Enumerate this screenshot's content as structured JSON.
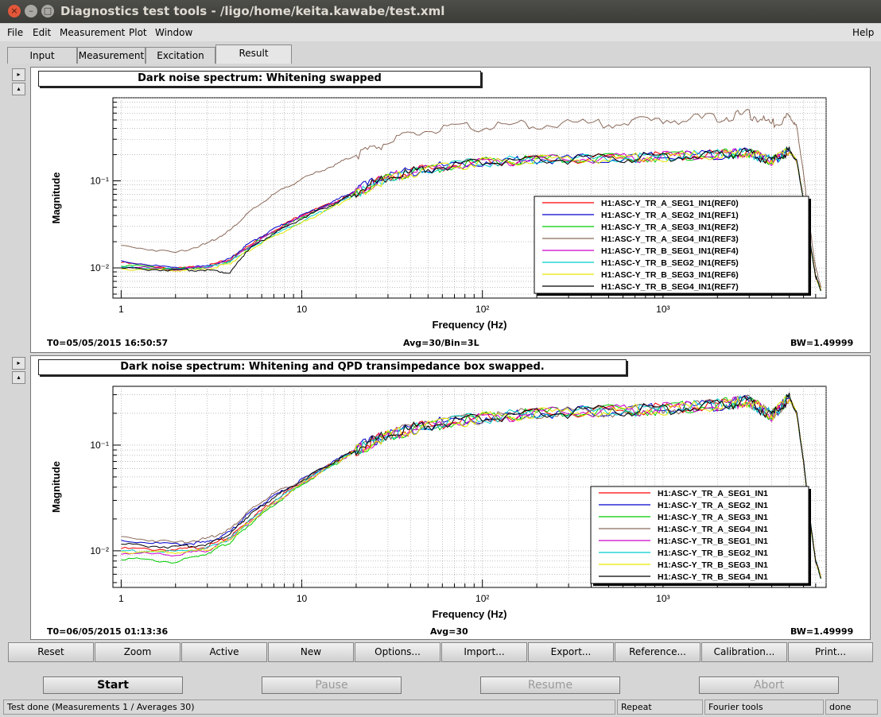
{
  "window": {
    "title": "Diagnostics test tools - /ligo/home/keita.kawabe/test.xml",
    "controls": [
      "×",
      "–",
      "□"
    ]
  },
  "menu": {
    "items": [
      "File",
      "Edit",
      "Measurement",
      "Plot",
      "Window"
    ],
    "help": "Help"
  },
  "tabs": [
    "Input",
    "Measurement",
    "Excitation",
    "Result"
  ],
  "side_buttons": {
    "expand": "▸",
    "collapse": "▴"
  },
  "plots": [
    {
      "title": "Dark noise spectrum: Whitening swapped",
      "t0": "T0=05/05/2015 16:50:57",
      "avg": "Avg=30/Bin=3L",
      "bw": "BW=1.49999"
    },
    {
      "title": "Dark noise spectrum: Whitening and QPD transimpedance box swapped.",
      "t0": "T0=06/05/2015 01:13:36",
      "avg": "Avg=30",
      "bw": "BW=1.49999"
    }
  ],
  "chart_data": [
    {
      "type": "line",
      "title": "Dark noise spectrum: Whitening swapped",
      "xlabel": "Frequency (Hz)",
      "ylabel": "Magnitude",
      "xscale": "log",
      "yscale": "log",
      "xlim": [
        0.9,
        8000
      ],
      "ylim": [
        0.0045,
        0.9
      ],
      "x_ticks": [
        "1",
        "10",
        "10²",
        "10³"
      ],
      "y_ticks": [
        "10⁻²",
        "10⁻¹"
      ],
      "grid": true,
      "legend": "bottom-right",
      "x": [
        1,
        2,
        3,
        4,
        5,
        7,
        10,
        15,
        20,
        30,
        50,
        100,
        200,
        500,
        1000,
        2000,
        3000,
        4000,
        5000,
        5500,
        6000,
        6500,
        7000,
        7500
      ],
      "series": [
        {
          "name": "H1:ASC-Y_TR_A_SEG1_IN1(REF0)",
          "color": "#ff0000",
          "values": [
            0.0115,
            0.0098,
            0.0105,
            0.0125,
            0.018,
            0.027,
            0.041,
            0.056,
            0.075,
            0.11,
            0.14,
            0.165,
            0.175,
            0.18,
            0.19,
            0.2,
            0.21,
            0.17,
            0.22,
            0.17,
            0.06,
            0.02,
            0.008,
            0.0055
          ]
        },
        {
          "name": "H1:ASC-Y_TR_A_SEG2_IN1(REF1)",
          "color": "#0000cc",
          "values": [
            0.012,
            0.0099,
            0.0104,
            0.0126,
            0.0185,
            0.028,
            0.04,
            0.058,
            0.078,
            0.115,
            0.14,
            0.165,
            0.176,
            0.18,
            0.19,
            0.2,
            0.21,
            0.17,
            0.22,
            0.17,
            0.06,
            0.02,
            0.008,
            0.0055
          ]
        },
        {
          "name": "H1:ASC-Y_TR_A_SEG3_IN1(REF2)",
          "color": "#00cc00",
          "values": [
            0.0108,
            0.0097,
            0.0103,
            0.012,
            0.017,
            0.026,
            0.038,
            0.055,
            0.073,
            0.11,
            0.138,
            0.163,
            0.175,
            0.18,
            0.19,
            0.2,
            0.21,
            0.17,
            0.22,
            0.17,
            0.06,
            0.02,
            0.008,
            0.0055
          ]
        },
        {
          "name": "H1:ASC-Y_TR_A_SEG4_IN1(REF3)",
          "color": "#8b6a5a",
          "values": [
            0.018,
            0.015,
            0.019,
            0.027,
            0.042,
            0.07,
            0.105,
            0.15,
            0.2,
            0.28,
            0.38,
            0.42,
            0.44,
            0.46,
            0.5,
            0.53,
            0.58,
            0.45,
            0.55,
            0.42,
            0.12,
            0.03,
            0.01,
            0.006
          ]
        },
        {
          "name": "H1:ASC-Y_TR_B_SEG1_IN1(REF4)",
          "color": "#cc00cc",
          "values": [
            0.0103,
            0.0096,
            0.0102,
            0.0122,
            0.017,
            0.026,
            0.039,
            0.055,
            0.074,
            0.11,
            0.139,
            0.164,
            0.175,
            0.18,
            0.19,
            0.2,
            0.21,
            0.17,
            0.22,
            0.17,
            0.06,
            0.02,
            0.008,
            0.0055
          ]
        },
        {
          "name": "H1:ASC-Y_TR_B_SEG2_IN1(REF5)",
          "color": "#00cccc",
          "values": [
            0.0102,
            0.0096,
            0.01,
            0.0118,
            0.016,
            0.024,
            0.034,
            0.052,
            0.071,
            0.108,
            0.137,
            0.163,
            0.175,
            0.18,
            0.19,
            0.2,
            0.21,
            0.17,
            0.22,
            0.17,
            0.06,
            0.02,
            0.008,
            0.0055
          ]
        },
        {
          "name": "H1:ASC-Y_TR_B_SEG3_IN1(REF6)",
          "color": "#e6e600",
          "values": [
            0.0098,
            0.0093,
            0.0097,
            0.0112,
            0.0155,
            0.023,
            0.033,
            0.05,
            0.07,
            0.106,
            0.137,
            0.163,
            0.175,
            0.18,
            0.19,
            0.2,
            0.21,
            0.17,
            0.22,
            0.17,
            0.06,
            0.02,
            0.008,
            0.0055
          ]
        },
        {
          "name": "H1:ASC-Y_TR_B_SEG4_IN1(REF7)",
          "color": "#000000",
          "values": [
            0.0099,
            0.0094,
            0.0095,
            0.0088,
            0.016,
            0.025,
            0.037,
            0.054,
            0.073,
            0.11,
            0.138,
            0.164,
            0.175,
            0.18,
            0.19,
            0.2,
            0.21,
            0.17,
            0.22,
            0.17,
            0.06,
            0.02,
            0.008,
            0.0055
          ]
        }
      ]
    },
    {
      "type": "line",
      "title": "Dark noise spectrum: Whitening and QPD transimpedance box swapped.",
      "xlabel": "Frequency (Hz)",
      "ylabel": "Magnitude",
      "xscale": "log",
      "yscale": "log",
      "xlim": [
        0.9,
        8000
      ],
      "ylim": [
        0.0045,
        0.36
      ],
      "x_ticks": [
        "1",
        "10",
        "10²",
        "10³"
      ],
      "y_ticks": [
        "10⁻²",
        "10⁻¹"
      ],
      "grid": true,
      "legend": "bottom-right",
      "x": [
        1,
        2,
        3,
        4,
        5,
        7,
        10,
        15,
        20,
        30,
        50,
        100,
        200,
        500,
        1000,
        2000,
        3000,
        4000,
        5000,
        5500,
        6000,
        6500,
        7000,
        7500
      ],
      "series": [
        {
          "name": "H1:ASC-Y_TR_A_SEG1_IN1",
          "color": "#ff0000",
          "values": [
            0.0105,
            0.0102,
            0.011,
            0.0135,
            0.019,
            0.03,
            0.045,
            0.068,
            0.09,
            0.125,
            0.155,
            0.18,
            0.2,
            0.21,
            0.22,
            0.24,
            0.26,
            0.19,
            0.28,
            0.2,
            0.07,
            0.02,
            0.008,
            0.0055
          ]
        },
        {
          "name": "H1:ASC-Y_TR_A_SEG2_IN1",
          "color": "#0000cc",
          "values": [
            0.0125,
            0.0115,
            0.012,
            0.015,
            0.022,
            0.033,
            0.047,
            0.07,
            0.092,
            0.127,
            0.156,
            0.181,
            0.2,
            0.21,
            0.22,
            0.24,
            0.26,
            0.19,
            0.28,
            0.2,
            0.07,
            0.02,
            0.008,
            0.0055
          ]
        },
        {
          "name": "H1:ASC-Y_TR_A_SEG3_IN1",
          "color": "#00cc00",
          "values": [
            0.0085,
            0.0078,
            0.0095,
            0.012,
            0.017,
            0.027,
            0.042,
            0.065,
            0.088,
            0.123,
            0.154,
            0.18,
            0.2,
            0.21,
            0.22,
            0.24,
            0.26,
            0.19,
            0.28,
            0.2,
            0.07,
            0.02,
            0.008,
            0.0055
          ]
        },
        {
          "name": "H1:ASC-Y_TR_A_SEG4_IN1",
          "color": "#8b6a5a",
          "values": [
            0.0135,
            0.012,
            0.013,
            0.016,
            0.023,
            0.035,
            0.046,
            0.069,
            0.09,
            0.126,
            0.155,
            0.18,
            0.2,
            0.21,
            0.22,
            0.24,
            0.26,
            0.19,
            0.28,
            0.2,
            0.07,
            0.02,
            0.008,
            0.0055
          ]
        },
        {
          "name": "H1:ASC-Y_TR_B_SEG1_IN1",
          "color": "#cc00cc",
          "values": [
            0.0095,
            0.0092,
            0.01,
            0.013,
            0.018,
            0.028,
            0.043,
            0.066,
            0.089,
            0.124,
            0.154,
            0.18,
            0.2,
            0.21,
            0.22,
            0.24,
            0.26,
            0.19,
            0.28,
            0.2,
            0.07,
            0.02,
            0.008,
            0.0055
          ]
        },
        {
          "name": "H1:ASC-Y_TR_B_SEG2_IN1",
          "color": "#00cccc",
          "values": [
            0.01,
            0.0098,
            0.0105,
            0.013,
            0.0185,
            0.029,
            0.044,
            0.067,
            0.09,
            0.125,
            0.155,
            0.18,
            0.2,
            0.21,
            0.22,
            0.24,
            0.26,
            0.19,
            0.28,
            0.2,
            0.07,
            0.02,
            0.008,
            0.0055
          ]
        },
        {
          "name": "H1:ASC-Y_TR_B_SEG3_IN1",
          "color": "#e6e600",
          "values": [
            0.0098,
            0.0096,
            0.0102,
            0.0128,
            0.018,
            0.028,
            0.043,
            0.066,
            0.089,
            0.124,
            0.154,
            0.18,
            0.2,
            0.21,
            0.22,
            0.24,
            0.26,
            0.19,
            0.28,
            0.2,
            0.07,
            0.02,
            0.008,
            0.0055
          ]
        },
        {
          "name": "H1:ASC-Y_TR_B_SEG4_IN1",
          "color": "#000000",
          "values": [
            0.0115,
            0.0108,
            0.0115,
            0.0145,
            0.021,
            0.032,
            0.046,
            0.069,
            0.091,
            0.126,
            0.155,
            0.18,
            0.2,
            0.21,
            0.22,
            0.24,
            0.26,
            0.19,
            0.28,
            0.2,
            0.07,
            0.02,
            0.008,
            0.0055
          ]
        }
      ]
    }
  ],
  "buttons": [
    "Reset",
    "Zoom",
    "Active",
    "New",
    "Options...",
    "Import...",
    "Export...",
    "Reference...",
    "Calibration...",
    "Print..."
  ],
  "controls": {
    "start": {
      "label": "Start",
      "enabled": true
    },
    "pause": {
      "label": "Pause",
      "enabled": false
    },
    "resume": {
      "label": "Resume",
      "enabled": false
    },
    "abort": {
      "label": "Abort",
      "enabled": false
    }
  },
  "status": {
    "message": "Test done (Measurements 1 / Averages 30)",
    "mode": "Repeat",
    "tool": "Fourier tools",
    "state": "done"
  }
}
